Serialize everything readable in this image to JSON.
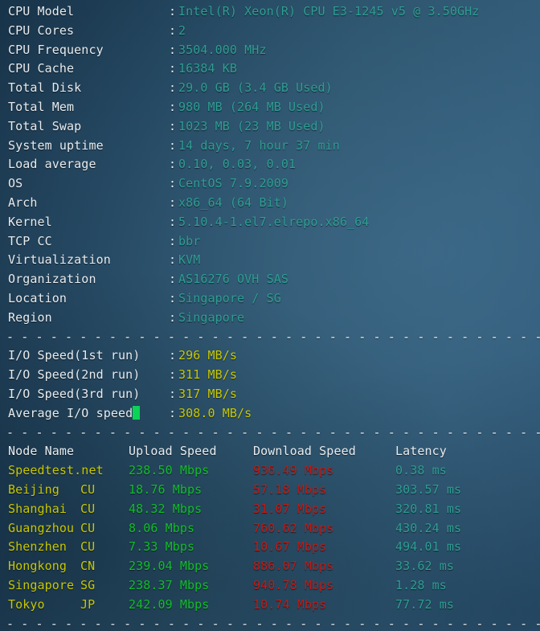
{
  "terminal": {
    "colors": {
      "background_dark": "#18344a",
      "background_light": "#2f5874",
      "label": "#e8ecef",
      "value_teal": "#2e9e92",
      "value_yellow": "#c8c800",
      "upload_green": "#12bd2a",
      "download_red": "#c21b16",
      "cursor_green": "#0ad356"
    },
    "separator": "----------------------------------------------------------------------"
  },
  "system_info": {
    "rows": [
      {
        "label": "CPU Model",
        "colon": ":",
        "value": "Intel(R) Xeon(R) CPU E3-1245 v5 @ 3.50GHz"
      },
      {
        "label": "CPU Cores",
        "colon": ":",
        "value": "2"
      },
      {
        "label": "CPU Frequency",
        "colon": ":",
        "value": "3504.000 MHz"
      },
      {
        "label": "CPU Cache",
        "colon": ":",
        "value": "16384 KB"
      },
      {
        "label": "Total Disk",
        "colon": ":",
        "value": "29.0 GB (3.4 GB Used)"
      },
      {
        "label": "Total Mem",
        "colon": ":",
        "value": "980 MB (264 MB Used)"
      },
      {
        "label": "Total Swap",
        "colon": ":",
        "value": "1023 MB (23 MB Used)"
      },
      {
        "label": "System uptime",
        "colon": ":",
        "value": "14 days, 7 hour 37 min"
      },
      {
        "label": "Load average",
        "colon": ":",
        "value": "0.10, 0.03, 0.01"
      },
      {
        "label": "OS",
        "colon": ":",
        "value": "CentOS 7.9.2009"
      },
      {
        "label": "Arch",
        "colon": ":",
        "value": "x86_64 (64 Bit)"
      },
      {
        "label": "Kernel",
        "colon": ":",
        "value": "5.10.4-1.el7.elrepo.x86_64"
      },
      {
        "label": "TCP CC",
        "colon": ":",
        "value": "bbr"
      },
      {
        "label": "Virtualization",
        "colon": ":",
        "value": "KVM"
      },
      {
        "label": "Organization",
        "colon": ":",
        "value": "AS16276 OVH SAS"
      },
      {
        "label": "Location",
        "colon": ":",
        "value": "Singapore / SG"
      },
      {
        "label": "Region",
        "colon": ":",
        "value": "Singapore"
      }
    ]
  },
  "io_speed": {
    "rows": [
      {
        "label": "I/O Speed(1st run)",
        "colon": ":",
        "value": "296 MB/s",
        "cursor": false
      },
      {
        "label": "I/O Speed(2nd run)",
        "colon": ":",
        "value": "311 MB/s",
        "cursor": false
      },
      {
        "label": "I/O Speed(3rd run)",
        "colon": ":",
        "value": "317 MB/s",
        "cursor": false
      },
      {
        "label": "Average I/O speed",
        "colon": ":",
        "value": "308.0 MB/s",
        "cursor": true
      }
    ]
  },
  "speedtest": {
    "headers": {
      "node": "Node Name",
      "upload": "Upload Speed",
      "download": "Download Speed",
      "latency": "Latency"
    },
    "rows": [
      {
        "node": "Speedtest.net",
        "cc": "",
        "upload": "238.50 Mbps",
        "download": "936.49 Mbps",
        "latency": "0.38 ms"
      },
      {
        "node": "Beijing",
        "cc": "CU",
        "upload": "18.76 Mbps",
        "download": "57.18 Mbps",
        "latency": "303.57 ms"
      },
      {
        "node": "Shanghai",
        "cc": "CU",
        "upload": "48.32 Mbps",
        "download": "31.07 Mbps",
        "latency": "320.81 ms"
      },
      {
        "node": "Guangzhou",
        "cc": "CU",
        "upload": "8.06 Mbps",
        "download": "760.62 Mbps",
        "latency": "430.24 ms"
      },
      {
        "node": "Shenzhen",
        "cc": "CU",
        "upload": "7.33 Mbps",
        "download": "10.67 Mbps",
        "latency": "494.01 ms"
      },
      {
        "node": "Hongkong",
        "cc": "CN",
        "upload": "239.04 Mbps",
        "download": "886.07 Mbps",
        "latency": "33.62 ms"
      },
      {
        "node": "Singapore",
        "cc": "SG",
        "upload": "238.37 Mbps",
        "download": "940.78 Mbps",
        "latency": "1.28 ms"
      },
      {
        "node": "Tokyo",
        "cc": "JP",
        "upload": "242.09 Mbps",
        "download": "10.74 Mbps",
        "latency": "77.72 ms"
      }
    ]
  }
}
